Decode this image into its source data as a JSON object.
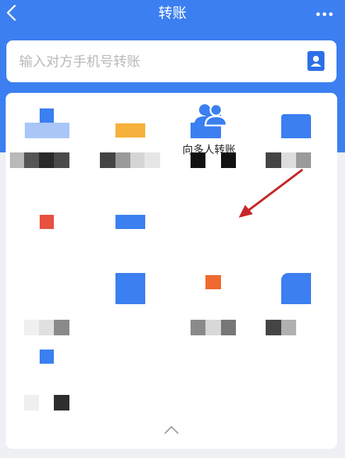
{
  "header": {
    "title": "转账",
    "back_icon": "chevron-left-icon",
    "more_icon": "more-dots-icon"
  },
  "search": {
    "placeholder": "输入对方手机号转账",
    "contact_icon": "contact-book-icon"
  },
  "features": {
    "multi_transfer": {
      "label": "向多人转账",
      "icon": "people-group-icon"
    }
  },
  "panel": {
    "collapse_icon": "chevron-up-icon"
  },
  "annotation": {
    "arrow_color": "#c62828"
  },
  "colors": {
    "brand_blue": "#3b7ff0",
    "background": "#eef0f4"
  }
}
